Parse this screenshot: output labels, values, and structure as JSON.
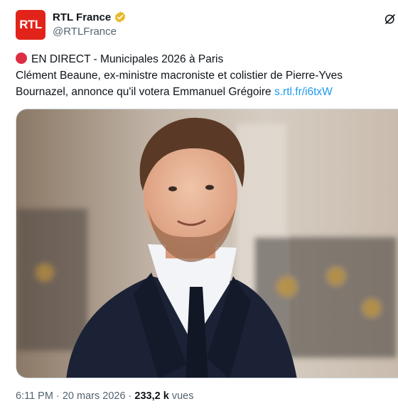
{
  "account": {
    "avatar_text": "RTL",
    "display_name": "RTL France",
    "handle": "@RTLFrance",
    "brand_color": "#e2231a",
    "verified_color": "#e8b829"
  },
  "tweet": {
    "line1": "EN DIRECT - Municipales 2026 à Paris",
    "line2_text": "Clément Beaune, ex-ministre macroniste et colistier de Pierre-Yves Bournazel, annonce qu'il votera Emmanuel Grégoire ",
    "link": "s.rtl.fr/i6txW",
    "status_icon": "red-circle-icon"
  },
  "meta": {
    "time": "6:11 PM",
    "separator": "·",
    "date": "20 mars 2026",
    "views_count": "233,2 k",
    "views_label": "vues"
  },
  "icons": {
    "top_right": "grok-icon",
    "verified": "verified-badge-icon"
  }
}
